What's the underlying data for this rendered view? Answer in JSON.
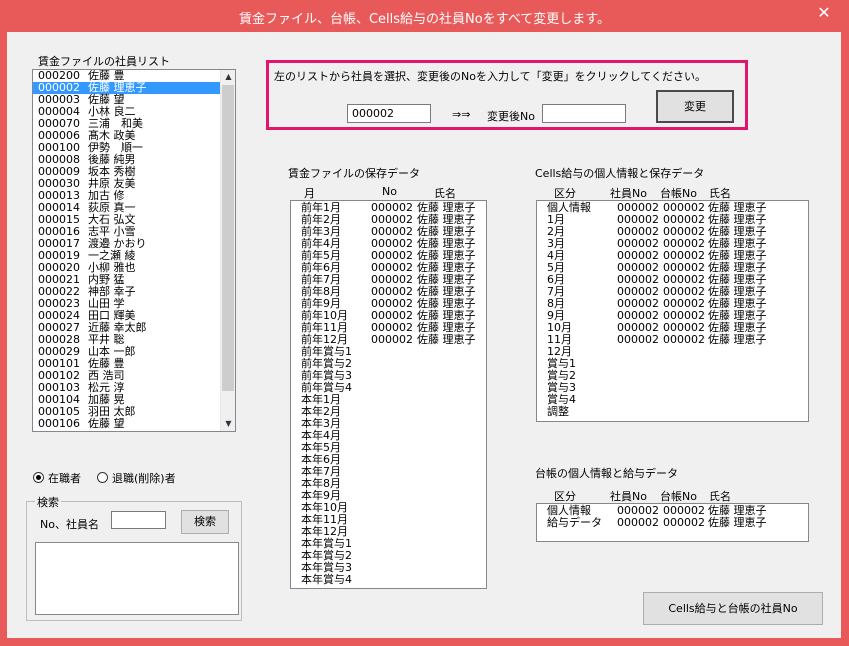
{
  "window": {
    "title": "賃金ファイル、台帳、Cells給与の社員Noをすべて変更します。",
    "close_glyph": "✕"
  },
  "employee_list": {
    "label": "賃金ファイルの社員リスト",
    "items": [
      {
        "no": "000200",
        "name": "佐藤 豊"
      },
      {
        "no": "000002",
        "name": "佐藤 理恵子"
      },
      {
        "no": "000003",
        "name": "佐藤 望"
      },
      {
        "no": "000004",
        "name": "小林 良二"
      },
      {
        "no": "000070",
        "name": "三浦　和美"
      },
      {
        "no": "000006",
        "name": "髙木 政美"
      },
      {
        "no": "000100",
        "name": "伊勢　順一"
      },
      {
        "no": "000008",
        "name": "後藤 純男"
      },
      {
        "no": "000009",
        "name": "坂本 秀樹"
      },
      {
        "no": "000030",
        "name": "井原 友美"
      },
      {
        "no": "000013",
        "name": "加古 修"
      },
      {
        "no": "000014",
        "name": "荻原 真一"
      },
      {
        "no": "000015",
        "name": "大石 弘文"
      },
      {
        "no": "000016",
        "name": "志平 小雪"
      },
      {
        "no": "000017",
        "name": "渡邉 かおり"
      },
      {
        "no": "000019",
        "name": "一之瀬 綾"
      },
      {
        "no": "000020",
        "name": "小柳 雅也"
      },
      {
        "no": "000021",
        "name": "内野 猛"
      },
      {
        "no": "000022",
        "name": "神部 幸子"
      },
      {
        "no": "000023",
        "name": "山田 学"
      },
      {
        "no": "000024",
        "name": "田口 輝美"
      },
      {
        "no": "000027",
        "name": "近藤 幸太郎"
      },
      {
        "no": "000028",
        "name": "平井 聡"
      },
      {
        "no": "000029",
        "name": "山本 一郎"
      },
      {
        "no": "000101",
        "name": "佐藤 豊"
      },
      {
        "no": "000102",
        "name": "西 浩司"
      },
      {
        "no": "000103",
        "name": "松元 淳"
      },
      {
        "no": "000104",
        "name": "加藤 晃"
      },
      {
        "no": "000105",
        "name": "羽田 太郎"
      },
      {
        "no": "000106",
        "name": "佐藤 望"
      }
    ],
    "selected_index": 1
  },
  "instruction": {
    "text": "左のリストから社員を選択、変更後のNoを入力して「変更」をクリックしてください。",
    "current_no": "000002",
    "arrow": "⇒⇒",
    "new_no_label": "変更後No",
    "new_no_value": "",
    "change_button": "変更"
  },
  "wage_file": {
    "title": "賃金ファイルの保存データ",
    "headers": {
      "month": "月",
      "no": "No",
      "name": "氏名"
    },
    "rows": [
      {
        "month": "前年1月",
        "no": "000002",
        "name": "佐藤 理恵子"
      },
      {
        "month": "前年2月",
        "no": "000002",
        "name": "佐藤 理恵子"
      },
      {
        "month": "前年3月",
        "no": "000002",
        "name": "佐藤 理恵子"
      },
      {
        "month": "前年4月",
        "no": "000002",
        "name": "佐藤 理恵子"
      },
      {
        "month": "前年5月",
        "no": "000002",
        "name": "佐藤 理恵子"
      },
      {
        "month": "前年6月",
        "no": "000002",
        "name": "佐藤 理恵子"
      },
      {
        "month": "前年7月",
        "no": "000002",
        "name": "佐藤 理恵子"
      },
      {
        "month": "前年8月",
        "no": "000002",
        "name": "佐藤 理恵子"
      },
      {
        "month": "前年9月",
        "no": "000002",
        "name": "佐藤 理恵子"
      },
      {
        "month": "前年10月",
        "no": "000002",
        "name": "佐藤 理恵子"
      },
      {
        "month": "前年11月",
        "no": "000002",
        "name": "佐藤 理恵子"
      },
      {
        "month": "前年12月",
        "no": "000002",
        "name": "佐藤 理恵子"
      },
      {
        "month": "前年賞与1",
        "no": "",
        "name": ""
      },
      {
        "month": "前年賞与2",
        "no": "",
        "name": ""
      },
      {
        "month": "前年賞与3",
        "no": "",
        "name": ""
      },
      {
        "month": "前年賞与4",
        "no": "",
        "name": ""
      },
      {
        "month": "本年1月",
        "no": "",
        "name": ""
      },
      {
        "month": "本年2月",
        "no": "",
        "name": ""
      },
      {
        "month": "本年3月",
        "no": "",
        "name": ""
      },
      {
        "month": "本年4月",
        "no": "",
        "name": ""
      },
      {
        "month": "本年5月",
        "no": "",
        "name": ""
      },
      {
        "month": "本年6月",
        "no": "",
        "name": ""
      },
      {
        "month": "本年7月",
        "no": "",
        "name": ""
      },
      {
        "month": "本年8月",
        "no": "",
        "name": ""
      },
      {
        "month": "本年9月",
        "no": "",
        "name": ""
      },
      {
        "month": "本年10月",
        "no": "",
        "name": ""
      },
      {
        "month": "本年11月",
        "no": "",
        "name": ""
      },
      {
        "month": "本年12月",
        "no": "",
        "name": ""
      },
      {
        "month": "本年賞与1",
        "no": "",
        "name": ""
      },
      {
        "month": "本年賞与2",
        "no": "",
        "name": ""
      },
      {
        "month": "本年賞与3",
        "no": "",
        "name": ""
      },
      {
        "month": "本年賞与4",
        "no": "",
        "name": ""
      }
    ]
  },
  "cells": {
    "title": "Cells給与の個人情報と保存データ",
    "headers": {
      "kubun": "区分",
      "emp_no": "社員No",
      "ledger_no": "台帳No",
      "name": "氏名"
    },
    "rows": [
      {
        "kubun": "個人情報",
        "emp_no": "000002",
        "ledger_no": "000002",
        "name": "佐藤 理恵子"
      },
      {
        "kubun": "1月",
        "emp_no": "000002",
        "ledger_no": "000002",
        "name": "佐藤 理恵子"
      },
      {
        "kubun": "2月",
        "emp_no": "000002",
        "ledger_no": "000002",
        "name": "佐藤 理恵子"
      },
      {
        "kubun": "3月",
        "emp_no": "000002",
        "ledger_no": "000002",
        "name": "佐藤 理恵子"
      },
      {
        "kubun": "4月",
        "emp_no": "000002",
        "ledger_no": "000002",
        "name": "佐藤 理恵子"
      },
      {
        "kubun": "5月",
        "emp_no": "000002",
        "ledger_no": "000002",
        "name": "佐藤 理恵子"
      },
      {
        "kubun": "6月",
        "emp_no": "000002",
        "ledger_no": "000002",
        "name": "佐藤 理恵子"
      },
      {
        "kubun": "7月",
        "emp_no": "000002",
        "ledger_no": "000002",
        "name": "佐藤 理恵子"
      },
      {
        "kubun": "8月",
        "emp_no": "000002",
        "ledger_no": "000002",
        "name": "佐藤 理恵子"
      },
      {
        "kubun": "9月",
        "emp_no": "000002",
        "ledger_no": "000002",
        "name": "佐藤 理恵子"
      },
      {
        "kubun": "10月",
        "emp_no": "000002",
        "ledger_no": "000002",
        "name": "佐藤 理恵子"
      },
      {
        "kubun": "11月",
        "emp_no": "000002",
        "ledger_no": "000002",
        "name": "佐藤 理恵子"
      },
      {
        "kubun": "12月",
        "emp_no": "",
        "ledger_no": "",
        "name": ""
      },
      {
        "kubun": "賞与1",
        "emp_no": "",
        "ledger_no": "",
        "name": ""
      },
      {
        "kubun": "賞与2",
        "emp_no": "",
        "ledger_no": "",
        "name": ""
      },
      {
        "kubun": "賞与3",
        "emp_no": "",
        "ledger_no": "",
        "name": ""
      },
      {
        "kubun": "賞与4",
        "emp_no": "",
        "ledger_no": "",
        "name": ""
      },
      {
        "kubun": "調整",
        "emp_no": "",
        "ledger_no": "",
        "name": ""
      }
    ]
  },
  "ledger": {
    "title": "台帳の個人情報と給与データ",
    "headers": {
      "kubun": "区分",
      "emp_no": "社員No",
      "ledger_no": "台帳No",
      "name": "氏名"
    },
    "rows": [
      {
        "kubun": "個人情報",
        "emp_no": "000002",
        "ledger_no": "000002",
        "name": "佐藤 理恵子"
      },
      {
        "kubun": "給与データ",
        "emp_no": "000002",
        "ledger_no": "000002",
        "name": "佐藤 理恵子"
      }
    ]
  },
  "status_filter": {
    "active_label": "在職者",
    "retired_label": "退職(削除)者",
    "selected": "active"
  },
  "search": {
    "group_title": "検索",
    "label": "No、社員名",
    "value": "",
    "button": "検索"
  },
  "bottom_button": "Cells給与と台帳の社員No",
  "icons": {
    "scroll_up": "scroll-up-arrow-icon",
    "scroll_down": "scroll-down-arrow-icon",
    "close": "close-icon"
  }
}
